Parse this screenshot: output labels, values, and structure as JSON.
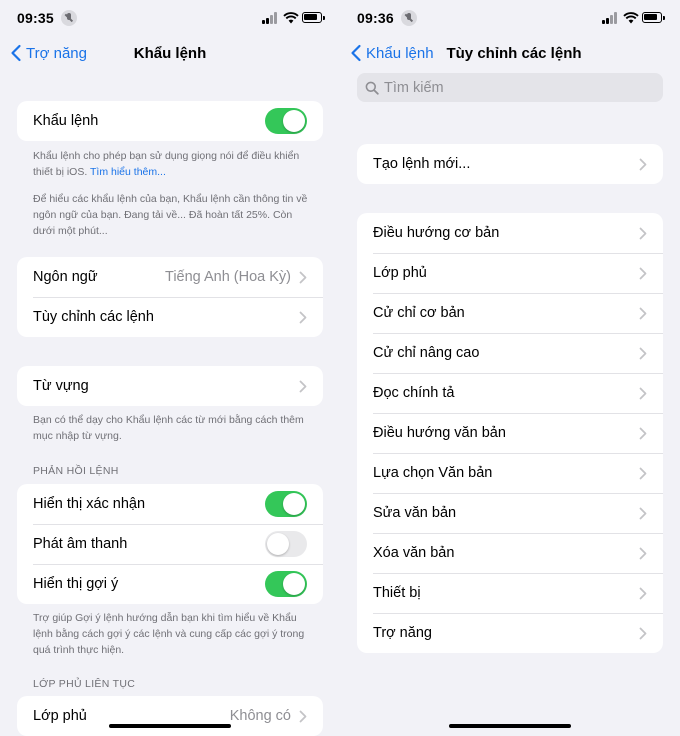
{
  "left": {
    "status": {
      "time": "09:35"
    },
    "nav": {
      "back": "Trợ năng",
      "title": "Khẩu lệnh"
    },
    "voice_control": {
      "label": "Khẩu lệnh",
      "toggle": true
    },
    "note1": {
      "text": "Khẩu lệnh cho phép bạn sử dụng giọng nói để điều khiển thiết bị iOS.",
      "link": "Tìm hiểu thêm..."
    },
    "note2": "Để hiểu các khẩu lệnh của bạn, Khẩu lệnh cần thông tin về ngôn ngữ của bạn. Đang tải về... Đã hoàn tất 25%. Còn dưới một phút...",
    "language": {
      "label": "Ngôn ngữ",
      "value": "Tiếng Anh (Hoa Kỳ)"
    },
    "customize": {
      "label": "Tùy chỉnh các lệnh"
    },
    "vocabulary": {
      "label": "Từ vựng"
    },
    "note3": "Bạn có thể dạy cho Khẩu lệnh các từ mới bằng cách thêm mục nhập từ vựng.",
    "feedback_header": "PHẢN HỒI LỆNH",
    "feedback": [
      {
        "label": "Hiển thị xác nhận",
        "toggle": true
      },
      {
        "label": "Phát âm thanh",
        "toggle": false
      },
      {
        "label": "Hiển thị gợi ý",
        "toggle": true
      }
    ],
    "note4": "Trợ giúp Gợi ý lệnh hướng dẫn bạn khi tìm hiểu về Khẩu lệnh bằng cách gợi ý các lệnh và cung cấp các gợi ý trong quá trình thực hiện.",
    "overlay_header": "LỚP PHỦ LIÊN TỤC",
    "overlay": {
      "label": "Lớp phủ",
      "value": "Không có"
    }
  },
  "right": {
    "status": {
      "time": "09:36"
    },
    "nav": {
      "back": "Khẩu lệnh",
      "title": "Tùy chỉnh các lệnh"
    },
    "search": {
      "placeholder": "Tìm kiếm"
    },
    "create": "Tạo lệnh mới...",
    "commands": [
      "Điều hướng cơ bản",
      "Lớp phủ",
      "Cử chỉ cơ bản",
      "Cử chỉ nâng cao",
      "Đọc chính tả",
      "Điều hướng văn bản",
      "Lựa chọn Văn bản",
      "Sửa văn bản",
      "Xóa văn bản",
      "Thiết bị",
      "Trợ năng"
    ]
  },
  "colors": {
    "accent": "#1a73e8",
    "toggle_on": "#34c759",
    "background": "#f2f2f7"
  }
}
